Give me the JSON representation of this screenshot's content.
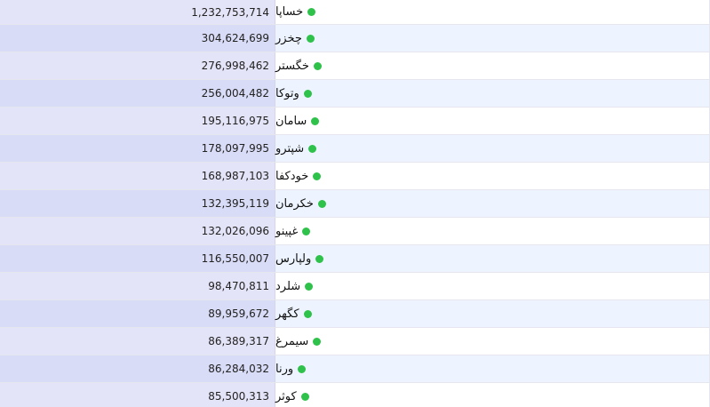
{
  "rows": [
    {
      "name": "خساپا",
      "value": "1,232,753,714",
      "status_color": "#2ec24a"
    },
    {
      "name": "چخزر",
      "value": "304,624,699",
      "status_color": "#2ec24a"
    },
    {
      "name": "خگستر",
      "value": "276,998,462",
      "status_color": "#2ec24a"
    },
    {
      "name": "وتوکا",
      "value": "256,004,482",
      "status_color": "#2ec24a"
    },
    {
      "name": "سامان",
      "value": "195,116,975",
      "status_color": "#2ec24a"
    },
    {
      "name": "شپترو",
      "value": "178,097,995",
      "status_color": "#2ec24a"
    },
    {
      "name": "خودکفا",
      "value": "168,987,103",
      "status_color": "#2ec24a"
    },
    {
      "name": "خکرمان",
      "value": "132,395,119",
      "status_color": "#2ec24a"
    },
    {
      "name": "غپینو",
      "value": "132,026,096",
      "status_color": "#2ec24a"
    },
    {
      "name": "ولپارس",
      "value": "116,550,007",
      "status_color": "#2ec24a"
    },
    {
      "name": "شلرد",
      "value": "98,470,811",
      "status_color": "#2ec24a"
    },
    {
      "name": "کگهر",
      "value": "89,959,672",
      "status_color": "#2ec24a"
    },
    {
      "name": "سیمرغ",
      "value": "86,389,317",
      "status_color": "#2ec24a"
    },
    {
      "name": "ورنا",
      "value": "86,284,032",
      "status_color": "#2ec24a"
    },
    {
      "name": "کوثر",
      "value": "85,500,313",
      "status_color": "#2ec24a"
    }
  ]
}
